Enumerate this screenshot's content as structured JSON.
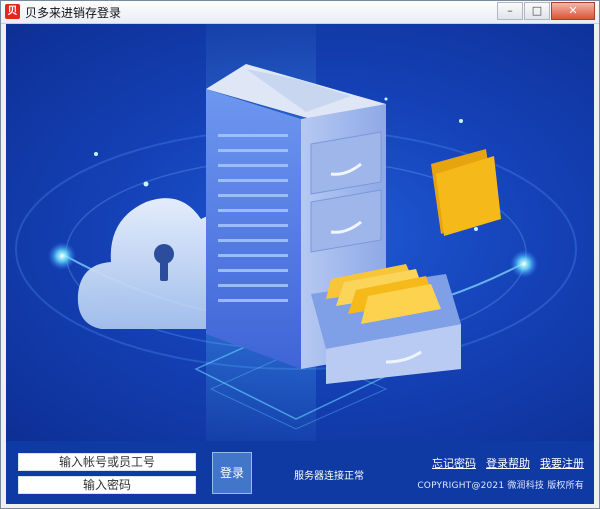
{
  "window": {
    "title": "贝多来进销存登录",
    "app_icon_glyph": "贝",
    "controls": {
      "minimize": "–",
      "maximize": "□",
      "close": "✕"
    }
  },
  "login": {
    "account_placeholder": "输入帐号或员工号",
    "password_placeholder": "输入密码",
    "login_label": "登录",
    "status": "服务器连接正常"
  },
  "links": {
    "forgot_password": "忘记密码",
    "login_help": "登录帮助",
    "register": "我要注册"
  },
  "footer": {
    "copyright": "COPYRIGHT@2021 微润科技 版权所有"
  },
  "colors": {
    "hero_bg": "#1542b8",
    "bottom_bar": "#0f3aa3",
    "login_button": "#4176c9",
    "folder": "#f5b91a"
  }
}
